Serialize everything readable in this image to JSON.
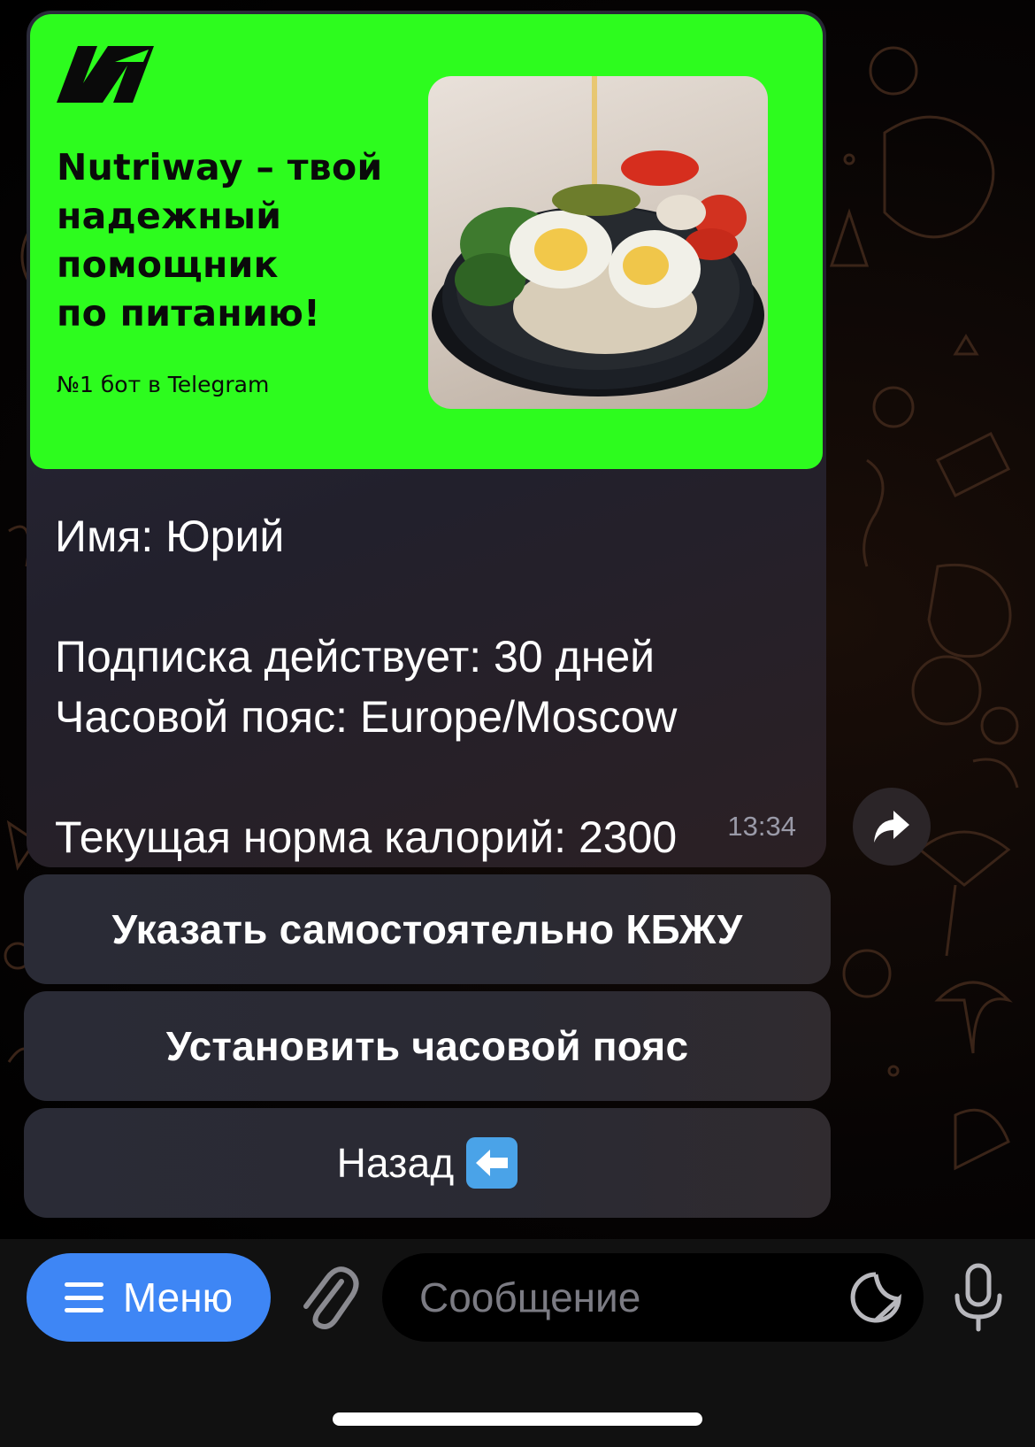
{
  "banner": {
    "title_lines": [
      "Nutriway – твой",
      "надежный",
      "помощник",
      "по питанию!"
    ],
    "subtitle": "№1 бот в Telegram",
    "accent_color": "#2dfc1e",
    "logo_icon": "nutriway-logo-icon",
    "photo": "salad-bowl-photo"
  },
  "message": {
    "lines": [
      "Имя: Юрий",
      "",
      "Подписка действует: 30 дней",
      "Часовой пояс: Europe/Moscow",
      "",
      "Текущая норма калорий: 2300"
    ],
    "time": "13:34"
  },
  "keyboard": {
    "buttons": [
      {
        "label": "Указать самостоятельно КБЖУ"
      },
      {
        "label": "Установить часовой пояс"
      },
      {
        "label": "Назад",
        "icon": "left-arrow-emoji-icon"
      }
    ]
  },
  "input_bar": {
    "menu_label": "Меню",
    "placeholder": "Сообщение",
    "menu_color": "#3e86f5"
  }
}
